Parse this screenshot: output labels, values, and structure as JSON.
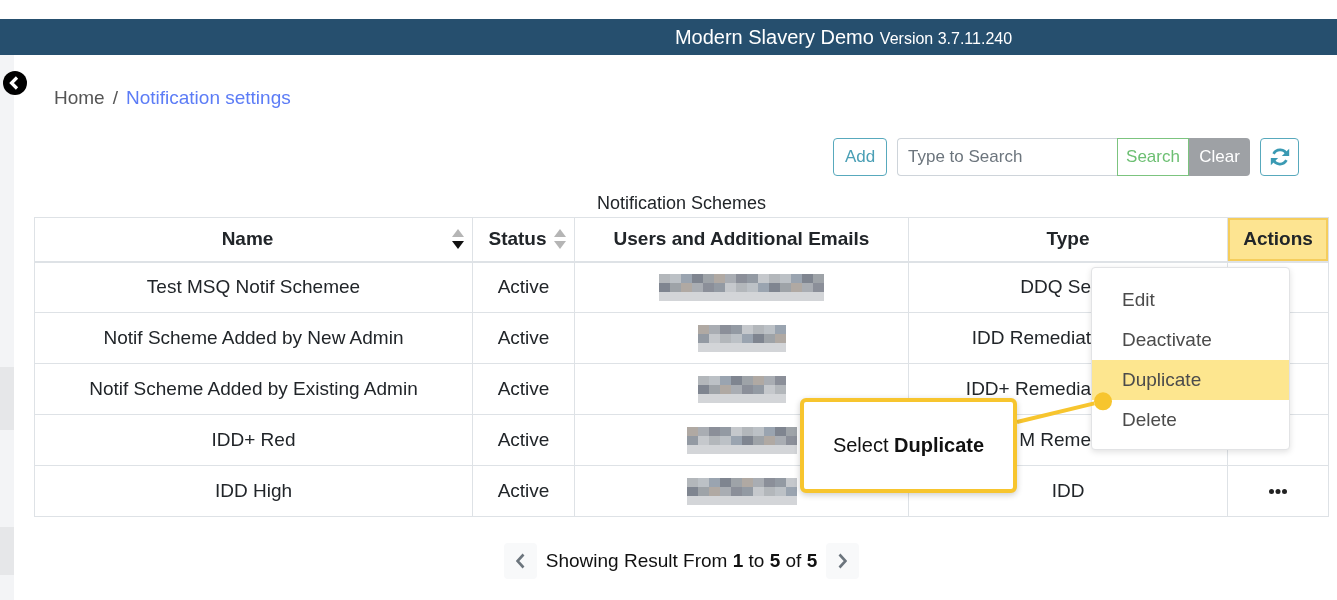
{
  "header": {
    "title": "Modern Slavery Demo",
    "version": "Version 3.7.11.240"
  },
  "breadcrumb": {
    "separator": "/",
    "items": [
      {
        "label": "Home",
        "current": false
      },
      {
        "label": "Notification settings",
        "current": true
      }
    ]
  },
  "toolbar": {
    "add_button": "Add",
    "search": {
      "placeholder": "Type to Search"
    },
    "search_button": "Search",
    "clear_button": "Clear"
  },
  "table": {
    "caption": "Notification Schemes",
    "columns": [
      {
        "label": "Name",
        "sorted": true,
        "highlighted": false
      },
      {
        "label": "Status",
        "sorted": false,
        "highlighted": false
      },
      {
        "label": "Users and Additional Emails",
        "highlighted": false
      },
      {
        "label": "Type",
        "highlighted": false
      },
      {
        "label": "Actions",
        "highlighted": true
      }
    ],
    "rows": [
      {
        "name": "Test MSQ Notif Schemee",
        "status": "Active",
        "type": "DDQ Se",
        "under_menu": true
      },
      {
        "name": "Notif Scheme Added by New Admin",
        "status": "Active",
        "type": "IDD Remediat",
        "under_menu": true
      },
      {
        "name": "Notif Scheme Added by Existing Admin",
        "status": "Active",
        "type": "IDD+ Remedia",
        "under_menu": true
      },
      {
        "name": "IDD+ Red",
        "status": "Active",
        "type": "M Reme",
        "under_menu": true
      },
      {
        "name": "IDD High",
        "status": "Active",
        "type": "IDD",
        "under_menu": false
      }
    ]
  },
  "context_menu": {
    "items": [
      {
        "label": "Edit",
        "selected": false
      },
      {
        "label": "Deactivate",
        "selected": false
      },
      {
        "label": "Duplicate",
        "selected": true
      },
      {
        "label": "Delete",
        "selected": false
      }
    ]
  },
  "callout": {
    "text": "Select **Duplicate**"
  },
  "pagination": {
    "summary": "Showing Result From **1** to **5** of **5**"
  }
}
